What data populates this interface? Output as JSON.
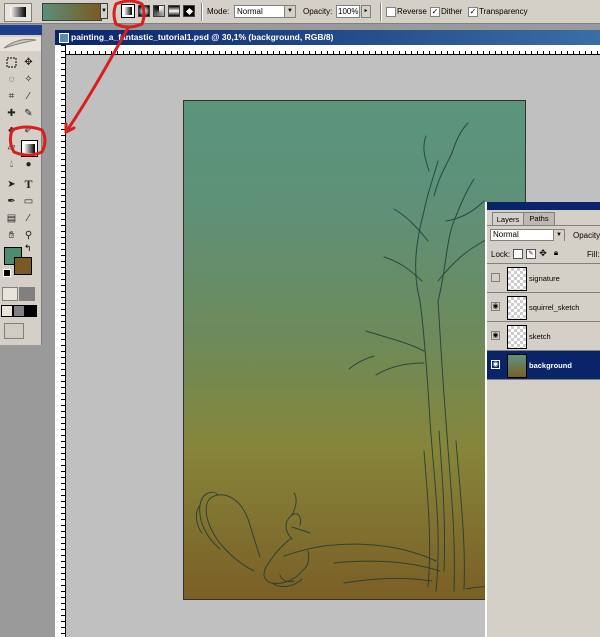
{
  "options_bar": {
    "gradient_preset_dropdown_icon": "triangle-down",
    "gradient_types": [
      "linear",
      "radial",
      "angle",
      "reflected",
      "diamond"
    ],
    "mode_label": "Mode:",
    "mode_value": "Normal",
    "opacity_label": "Opacity:",
    "opacity_value": "100%",
    "reverse_label": "Reverse",
    "reverse_checked": false,
    "dither_label": "Dither",
    "dither_checked": true,
    "transparency_label": "Transparency",
    "transparency_checked": true
  },
  "colors": {
    "foreground": "#4e8c70",
    "background": "#7a5a22",
    "annotation": "#d81e1e"
  },
  "document": {
    "title": "painting_a_fantastic_tutorial1.psd @ 30,1% (background, RGB/8)"
  },
  "toolbox": {
    "type_tool_glyph": "T"
  },
  "layers_panel": {
    "tabs": [
      "Layers",
      "Paths"
    ],
    "blend_mode": "Normal",
    "opacity_label": "Opacity:",
    "lock_label": "Lock:",
    "fill_label": "Fill:",
    "layers": [
      {
        "name": "signature",
        "visible": false,
        "selected": false
      },
      {
        "name": "squirrel_sketch",
        "visible": true,
        "selected": false
      },
      {
        "name": "sketch",
        "visible": true,
        "selected": false
      },
      {
        "name": "background",
        "visible": true,
        "selected": true
      }
    ]
  }
}
